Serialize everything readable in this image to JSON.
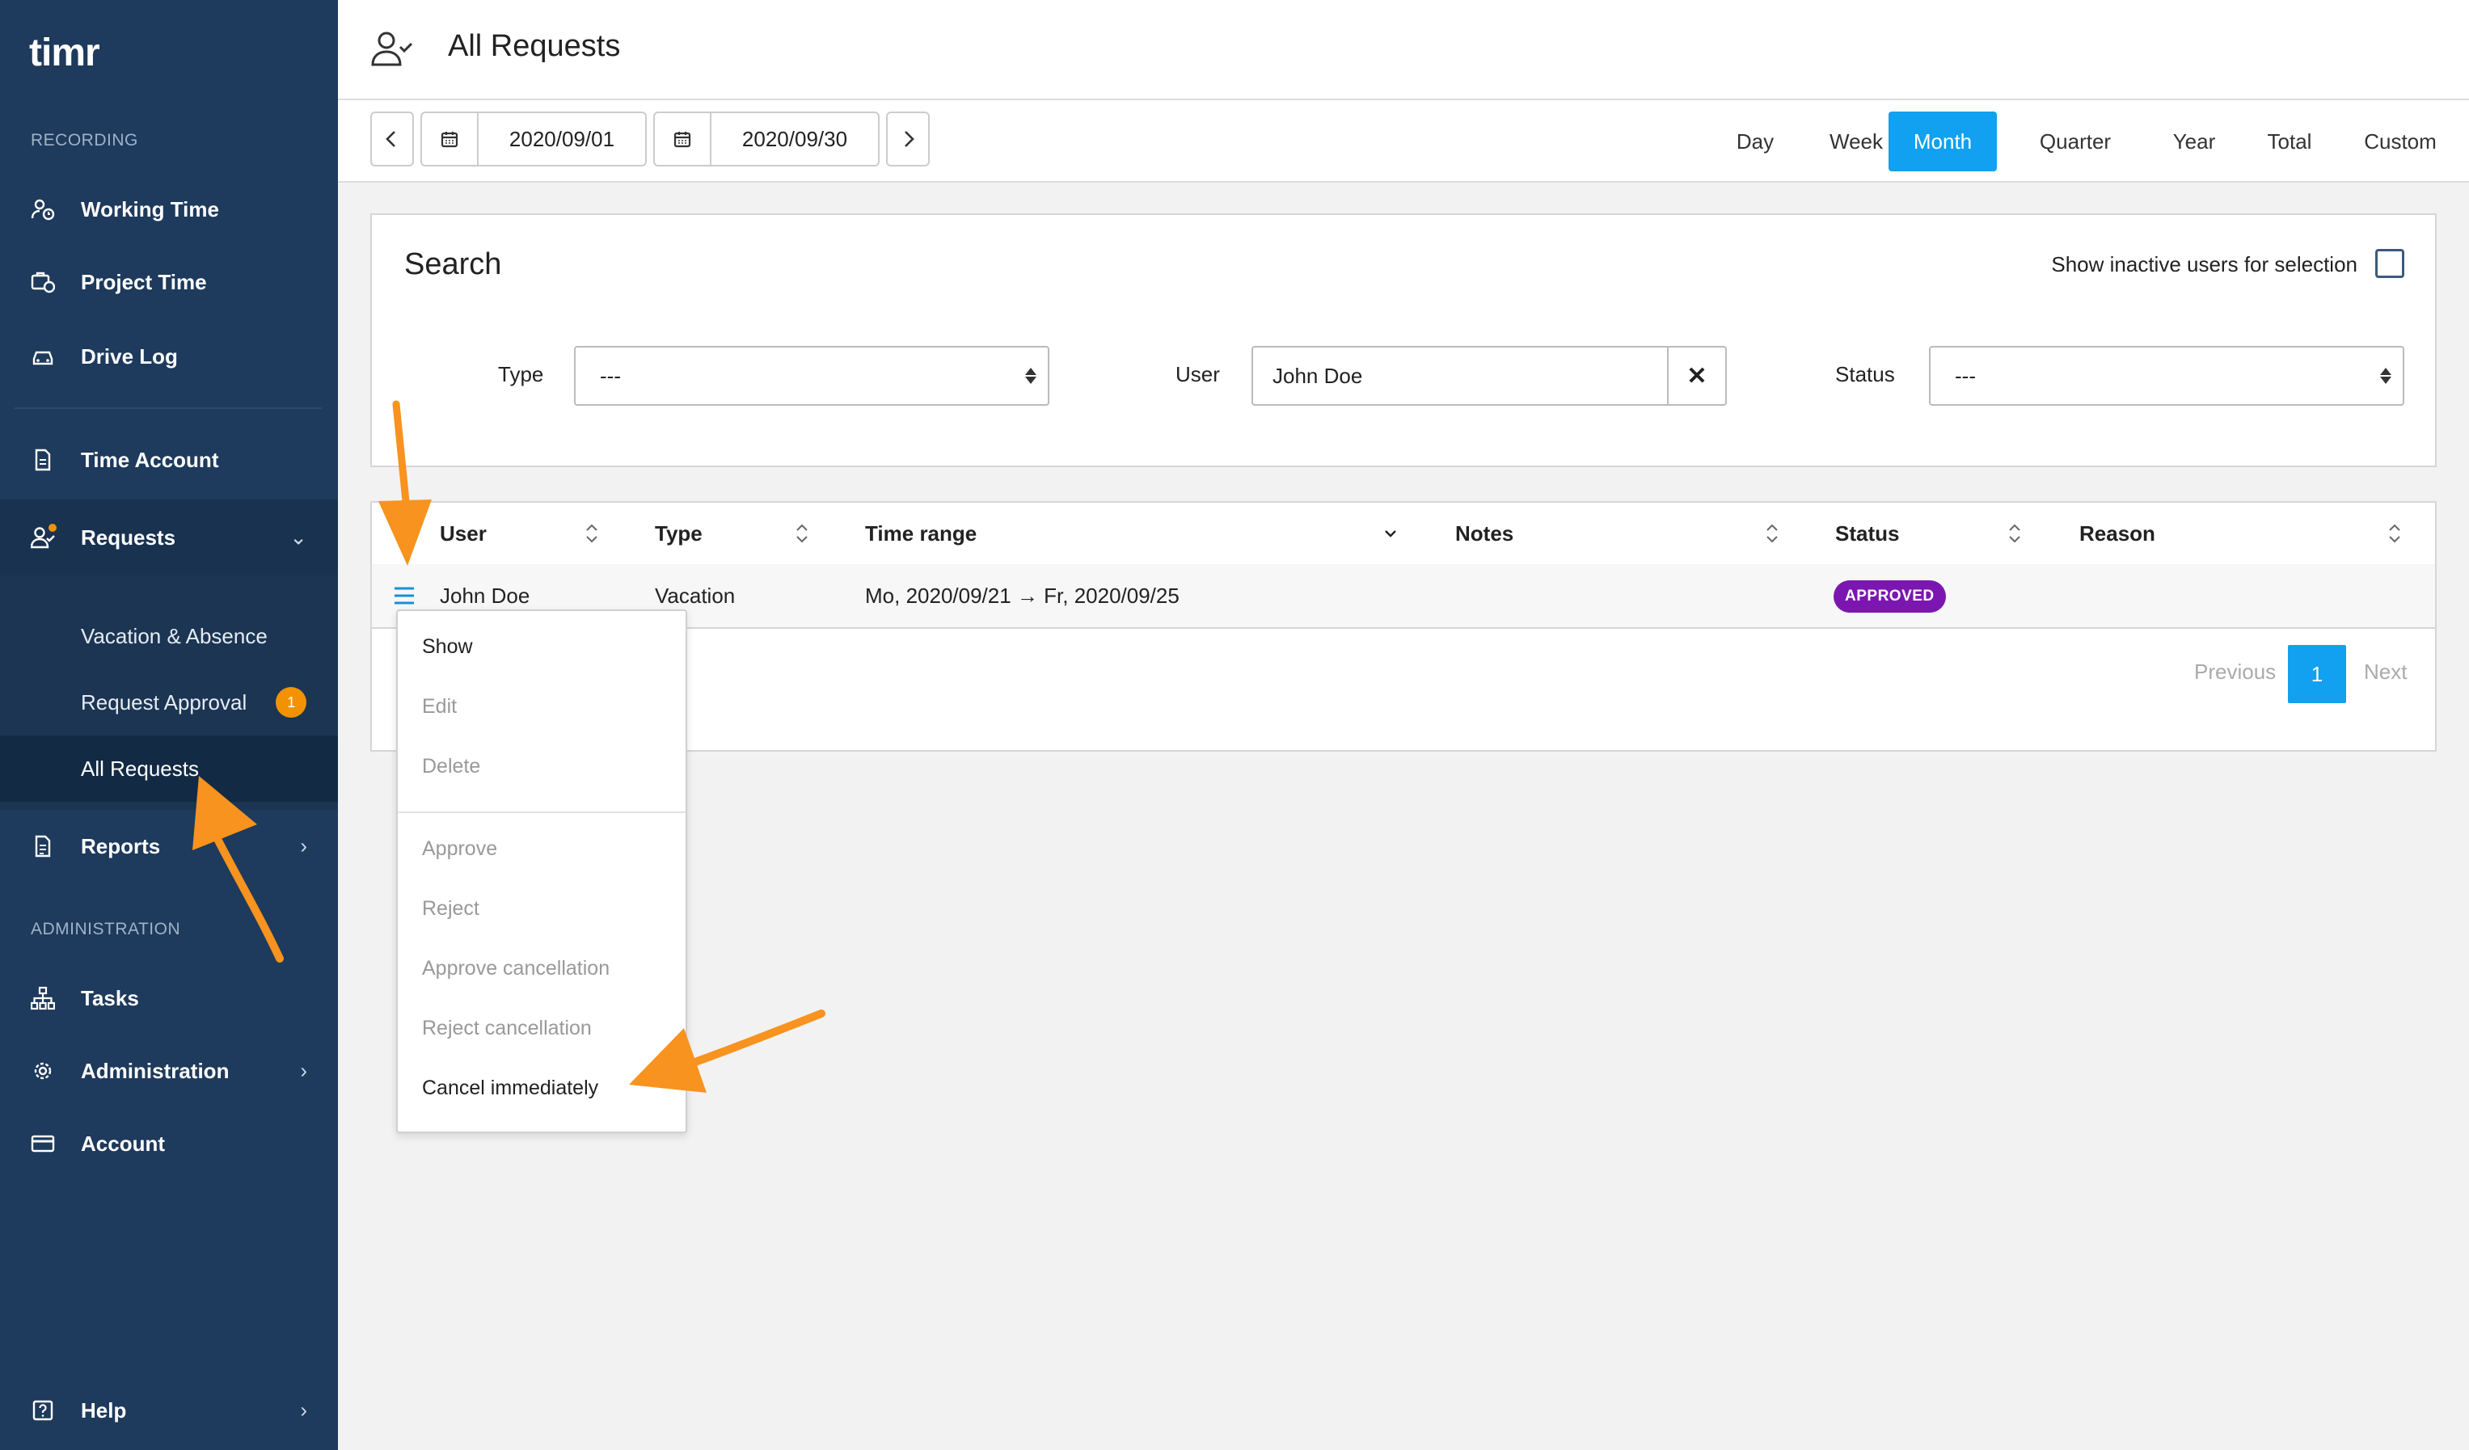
{
  "app": {
    "logo_text": "timr"
  },
  "sidebar": {
    "section_recording": "RECORDING",
    "section_administration": "ADMINISTRATION",
    "items": [
      {
        "label": "Working Time",
        "icon": "working-time-icon"
      },
      {
        "label": "Project Time",
        "icon": "project-time-icon"
      },
      {
        "label": "Drive Log",
        "icon": "car-icon"
      },
      {
        "label": "Time Account",
        "icon": "document-icon"
      },
      {
        "label": "Requests",
        "icon": "user-check-icon"
      },
      {
        "label": "Reports",
        "icon": "report-icon"
      },
      {
        "label": "Tasks",
        "icon": "sitemap-icon"
      },
      {
        "label": "Administration",
        "icon": "gear-icon"
      },
      {
        "label": "Account",
        "icon": "card-icon"
      },
      {
        "label": "Help",
        "icon": "help-icon"
      }
    ],
    "requests_sub": [
      {
        "label": "Vacation & Absence"
      },
      {
        "label": "Request Approval",
        "badge": "1"
      },
      {
        "label": "All Requests"
      }
    ]
  },
  "header": {
    "title": "All Requests"
  },
  "toolbar": {
    "date_from": "2020/09/01",
    "date_to": "2020/09/30",
    "periods": [
      "Day",
      "Week",
      "Month",
      "Quarter",
      "Year",
      "Total",
      "Custom"
    ],
    "active_period": "Month"
  },
  "search": {
    "title": "Search",
    "inactive_label": "Show inactive users for selection",
    "type_label": "Type",
    "type_value": "---",
    "user_label": "User",
    "user_value": "John Doe",
    "clear_symbol": "✕",
    "status_label": "Status",
    "status_value": "---"
  },
  "table": {
    "columns": [
      "User",
      "Type",
      "Time range",
      "Notes",
      "Status",
      "Reason"
    ],
    "rows": [
      {
        "user": "John Doe",
        "type": "Vacation",
        "time_range": "Mo, 2020/09/21 → Fr, 2020/09/25",
        "notes": "",
        "status": "APPROVED",
        "reason": ""
      }
    ],
    "pagination": {
      "previous": "Previous",
      "page": "1",
      "next": "Next"
    }
  },
  "row_menu": {
    "items": [
      "Show",
      "Edit",
      "Delete",
      "Approve",
      "Reject",
      "Approve cancellation",
      "Reject cancellation",
      "Cancel immediately"
    ]
  },
  "colors": {
    "sidebar": "#1e3a5c",
    "accent": "#12a0f0",
    "badge": "#f39200",
    "approved": "#7b17b0",
    "annotation_arrow": "#f7931e"
  }
}
